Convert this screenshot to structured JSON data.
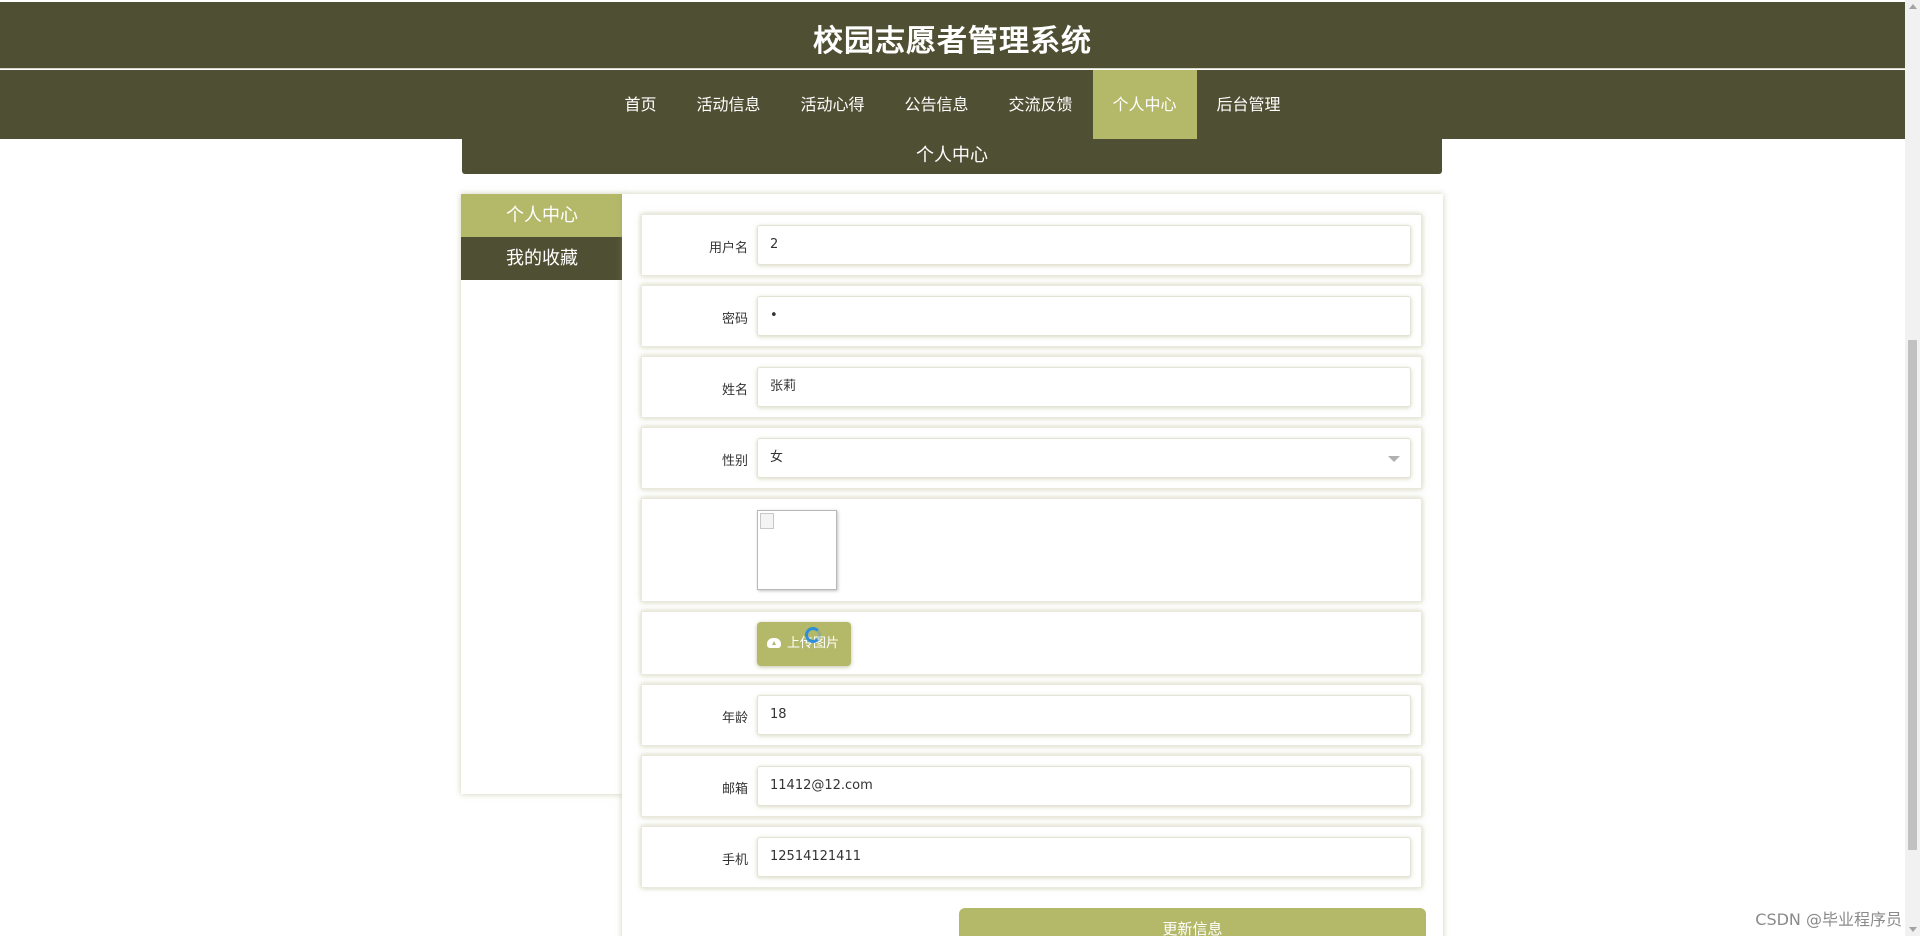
{
  "header": {
    "title": "校园志愿者管理系统"
  },
  "nav": {
    "items": [
      {
        "label": "首页",
        "active": false
      },
      {
        "label": "活动信息",
        "active": false
      },
      {
        "label": "活动心得",
        "active": false
      },
      {
        "label": "公告信息",
        "active": false
      },
      {
        "label": "交流反馈",
        "active": false
      },
      {
        "label": "个人中心",
        "active": true
      },
      {
        "label": "后台管理",
        "active": false
      }
    ]
  },
  "section_title": "个人中心",
  "sidebar": {
    "items": [
      {
        "label": "个人中心",
        "active": true
      },
      {
        "label": "我的收藏",
        "active": false
      }
    ]
  },
  "form": {
    "username": {
      "label": "用户名",
      "value": "2"
    },
    "password": {
      "label": "密码",
      "value": "•"
    },
    "name": {
      "label": "姓名",
      "value": "张莉"
    },
    "gender": {
      "label": "性别",
      "value": "女"
    },
    "upload_label": "上传图片",
    "age": {
      "label": "年龄",
      "value": "18"
    },
    "email": {
      "label": "邮箱",
      "value": "11412@12.com"
    },
    "phone": {
      "label": "手机",
      "value": "12514121411"
    },
    "submit_label": "更新信息"
  },
  "watermark": "CSDN @毕业程序员",
  "colors": {
    "header_bg": "#4f4f33",
    "accent": "#b4b96a"
  }
}
